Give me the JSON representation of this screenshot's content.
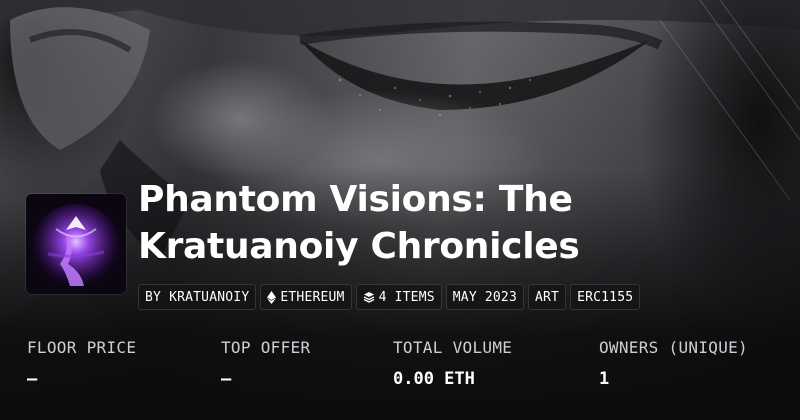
{
  "collection": {
    "title": "Phantom Visions: The Kratuanoiy Chronicles"
  },
  "tags": {
    "creator": "BY KRATUANOIY",
    "chain": "ETHEREUM",
    "items": "4 ITEMS",
    "date": "MAY 2023",
    "category": "ART",
    "standard": "ERC1155"
  },
  "stats": [
    {
      "label": "FLOOR PRICE",
      "value": "—"
    },
    {
      "label": "TOP OFFER",
      "value": "—"
    },
    {
      "label": "TOTAL VOLUME",
      "value": "0.00 ETH"
    },
    {
      "label": "OWNERS (UNIQUE)",
      "value": "1"
    }
  ],
  "icons": {
    "chain": "ethereum-icon",
    "items": "layers-icon"
  },
  "colors": {
    "background": "#0c0c0e",
    "thumbnail_glow": "#a64dff",
    "text": "#ffffff"
  }
}
